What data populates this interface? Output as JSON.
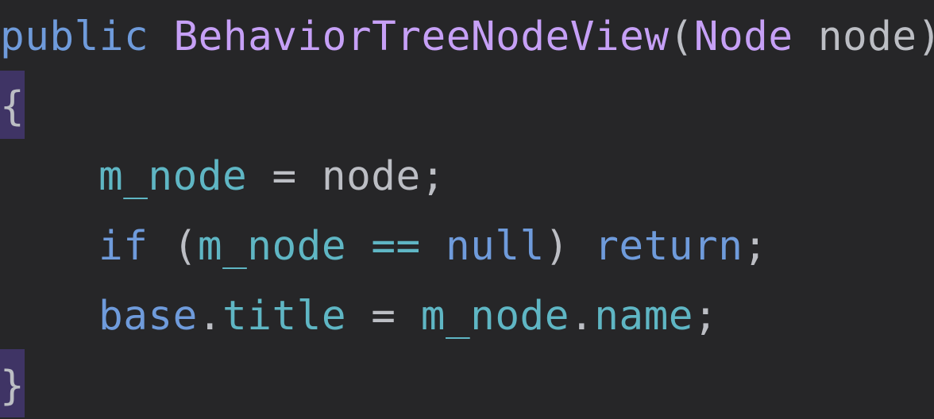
{
  "code": {
    "line1": {
      "keyword": "public",
      "method": "BehaviorTreeNodeView",
      "open_paren": "(",
      "param_type": "Node",
      "param_name": "node",
      "close_paren": ")"
    },
    "line2": {
      "brace": "{"
    },
    "line3": {
      "field": "m_node",
      "operator": "=",
      "value": "node",
      "semicolon": ";"
    },
    "line4": {
      "keyword_if": "if",
      "open_paren": "(",
      "field": "m_node",
      "operator": "==",
      "null_kw": "null",
      "close_paren": ")",
      "keyword_return": "return",
      "semicolon": ";"
    },
    "line5": {
      "base_kw": "base",
      "dot1": ".",
      "prop": "title",
      "operator": "=",
      "field": "m_node",
      "dot2": ".",
      "member": "name",
      "semicolon": ";"
    },
    "line6": {
      "brace": "}"
    }
  },
  "colors": {
    "background": "#262628",
    "keyword": "#6f9bdb",
    "method": "#c6a0f6",
    "field": "#5fb6c4",
    "plain": "#bcbec4",
    "brace_highlight": "#3f3465"
  }
}
